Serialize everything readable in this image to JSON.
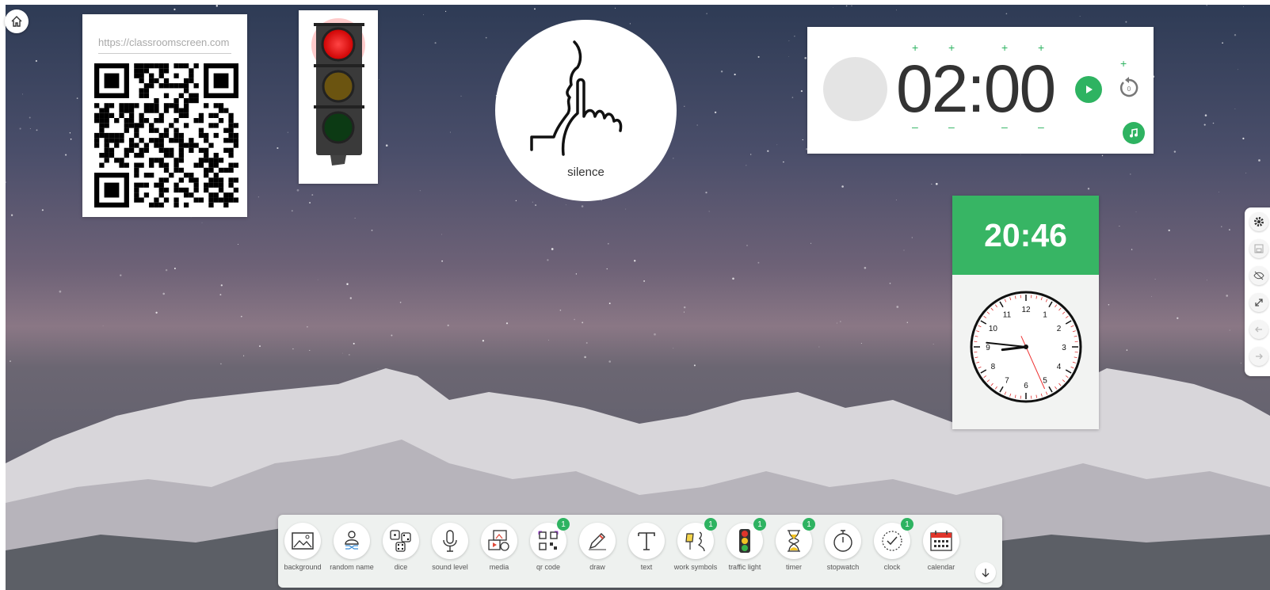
{
  "qr_widget": {
    "url": "https://classroomscreen.com"
  },
  "silence_widget": {
    "label": "silence",
    "icon": "silence-face-icon"
  },
  "timer": {
    "display": "02:00",
    "plus": "+",
    "minus": "–",
    "accent": "#2eb361"
  },
  "clock": {
    "digital_time": "20:46",
    "numbers": [
      "12",
      "1",
      "2",
      "3",
      "4",
      "5",
      "6",
      "7",
      "8",
      "9",
      "10",
      "11"
    ],
    "accent": "#37b564"
  },
  "side_panel": {
    "items": [
      "gear-icon",
      "save-icon",
      "hide-icon",
      "fullscreen-icon",
      "back-arrow-icon",
      "forward-arrow-icon"
    ]
  },
  "toolbar": {
    "items": [
      {
        "label": "background",
        "badge": ""
      },
      {
        "label": "random name",
        "badge": ""
      },
      {
        "label": "dice",
        "badge": ""
      },
      {
        "label": "sound level",
        "badge": ""
      },
      {
        "label": "media",
        "badge": ""
      },
      {
        "label": "qr code",
        "badge": "1"
      },
      {
        "label": "draw",
        "badge": ""
      },
      {
        "label": "text",
        "badge": ""
      },
      {
        "label": "work symbols",
        "badge": "1"
      },
      {
        "label": "traffic light",
        "badge": "1"
      },
      {
        "label": "timer",
        "badge": "1"
      },
      {
        "label": "stopwatch",
        "badge": ""
      },
      {
        "label": "clock",
        "badge": "1"
      },
      {
        "label": "calendar",
        "badge": ""
      }
    ]
  }
}
